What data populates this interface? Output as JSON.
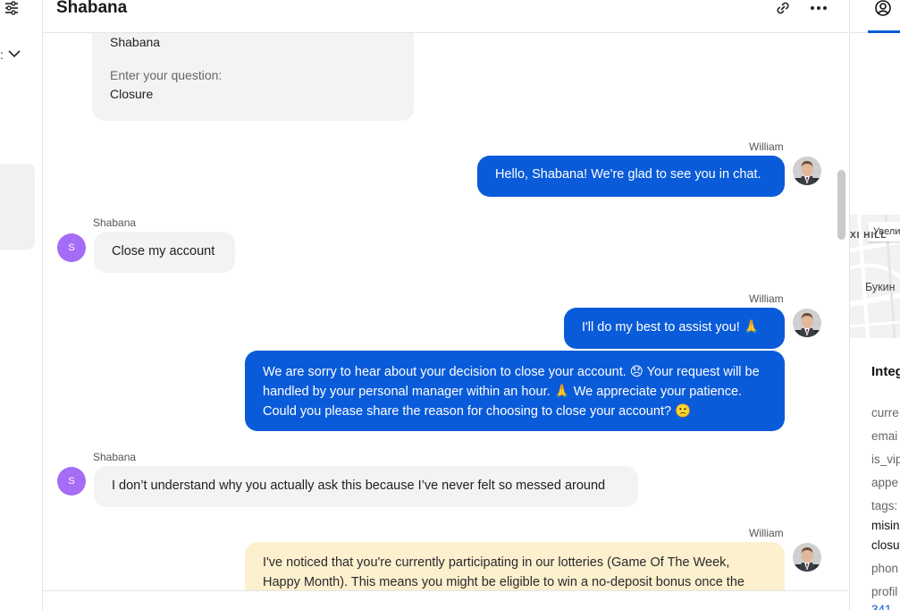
{
  "chat_title": "Shabana",
  "form": {
    "name_value": "Shabana",
    "question_label": "Enter your question:",
    "question_value": "Closure"
  },
  "agent": {
    "name": "William"
  },
  "customer": {
    "name": "Shabana",
    "initial": "S"
  },
  "messages": [
    {
      "sender": "William",
      "text": "Hello, Shabana! We're glad to see you in chat."
    },
    {
      "sender": "Shabana",
      "text": "Close my account"
    },
    {
      "sender": "William",
      "text": "I'll do my best to assist you! 🙏"
    },
    {
      "sender": "William",
      "text": "We are sorry to hear about your decision to close your account. 😞 Your request will be handled by your personal manager within an hour. 🙏 We appreciate your patience. Could you please share the reason for choosing to close your account? 🙁"
    },
    {
      "sender": "Shabana",
      "text": "I don’t understand why you actually ask this because I’ve never felt so messed around"
    },
    {
      "sender": "William",
      "text": "I've noticed that you're currently participating in our lotteries (Game Of The Week, Happy Month). This means you might be eligible to win a no-deposit bonus once the"
    }
  ],
  "right_panel": {
    "map_zoom_label": "Увели",
    "map_district": "XI HILL",
    "map_street": "Букин",
    "integrations_heading": "Integ",
    "fields": [
      "curre",
      "emai",
      "is_vip",
      "appe",
      "tags:"
    ],
    "tag_values": [
      "misin",
      "closu"
    ],
    "more_fields": [
      "phon",
      "profil"
    ],
    "profile_link": "341"
  }
}
